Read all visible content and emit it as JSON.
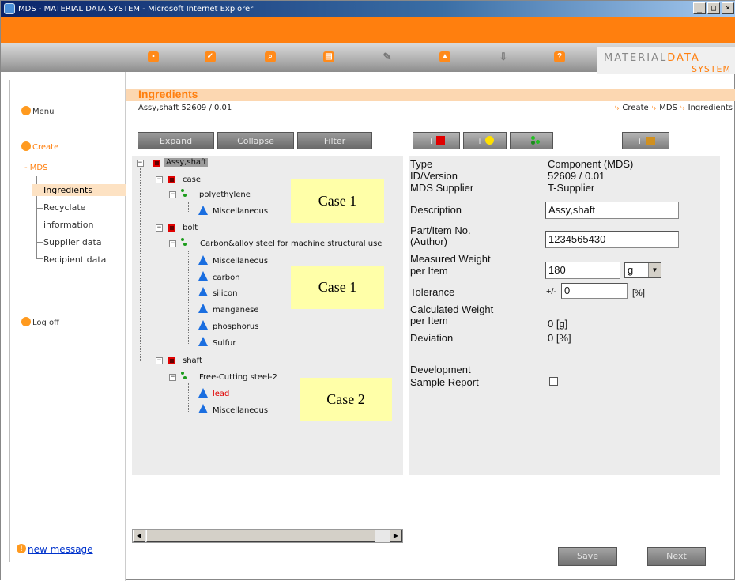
{
  "window": {
    "title": "MDS - MATERIAL DATA SYSTEM - Microsoft Internet Explorer",
    "buttons": [
      "_",
      "□",
      "×"
    ]
  },
  "brand": {
    "line1_plain": "MATERIAL",
    "line1_accent": "DATA",
    "line2": "SYSTEM"
  },
  "sidebar": {
    "menu": "Menu",
    "create": "Create",
    "mds": "MDS",
    "items": [
      "Ingredients",
      "Recyclate",
      "information",
      "Supplier data",
      "Recipient data"
    ],
    "logoff": "Log off",
    "new_message": "new message"
  },
  "page": {
    "title": "Ingredients",
    "subtitle": "Assy,shaft 52609 / 0.01",
    "breadcrumbs": [
      "Create",
      "MDS",
      "Ingredients"
    ]
  },
  "tree_buttons": {
    "expand": "Expand",
    "collapse": "Collapse",
    "filter": "Filter"
  },
  "add_buttons": {
    "plus": "+"
  },
  "tree": {
    "root": "Assy,shaft",
    "case": "case",
    "polyethylene": "polyethylene",
    "misc1": "Miscellaneous",
    "bolt": "bolt",
    "carbon_steel": "Carbon&alloy steel for machine structural use",
    "misc2": "Miscellaneous",
    "carbon": "carbon",
    "silicon": "silicon",
    "manganese": "manganese",
    "phosphorus": "phosphorus",
    "sulfur": "Sulfur",
    "shaft": "shaft",
    "free_cutting": "Free-Cutting steel-2",
    "lead": "lead",
    "misc3": "Miscellaneous"
  },
  "annotations": [
    "Case 1",
    "Case 1",
    "Case 2"
  ],
  "details": {
    "type_label": "Type",
    "type_value": "Component (MDS)",
    "id_label": "ID/Version",
    "id_value": "52609 / 0.01",
    "supplier_label": "MDS Supplier",
    "supplier_value": "T-Supplier",
    "description_label": "Description",
    "description_value": "Assy,shaft",
    "part_label_1": "Part/Item No.",
    "part_label_2": "(Author)",
    "part_value": "1234565430",
    "mweight_label_1": "Measured Weight",
    "mweight_label_2": "per Item",
    "mweight_value": "180",
    "mweight_unit": "g",
    "tolerance_label": "Tolerance",
    "tolerance_prefix": "+/-",
    "tolerance_value": "0",
    "tolerance_unit": "[%]",
    "cweight_label_1": "Calculated Weight",
    "cweight_label_2": "per Item",
    "cweight_value": "0 [g]",
    "deviation_label": "Deviation",
    "deviation_value": "0 [%]",
    "dev_label_1": "Development",
    "dev_label_2": "Sample Report"
  },
  "bottom": {
    "save": "Save",
    "next": "Next"
  },
  "colors": {
    "accent": "#ff7f0e",
    "panel": "#ececec",
    "button": "#7e7e7e"
  }
}
